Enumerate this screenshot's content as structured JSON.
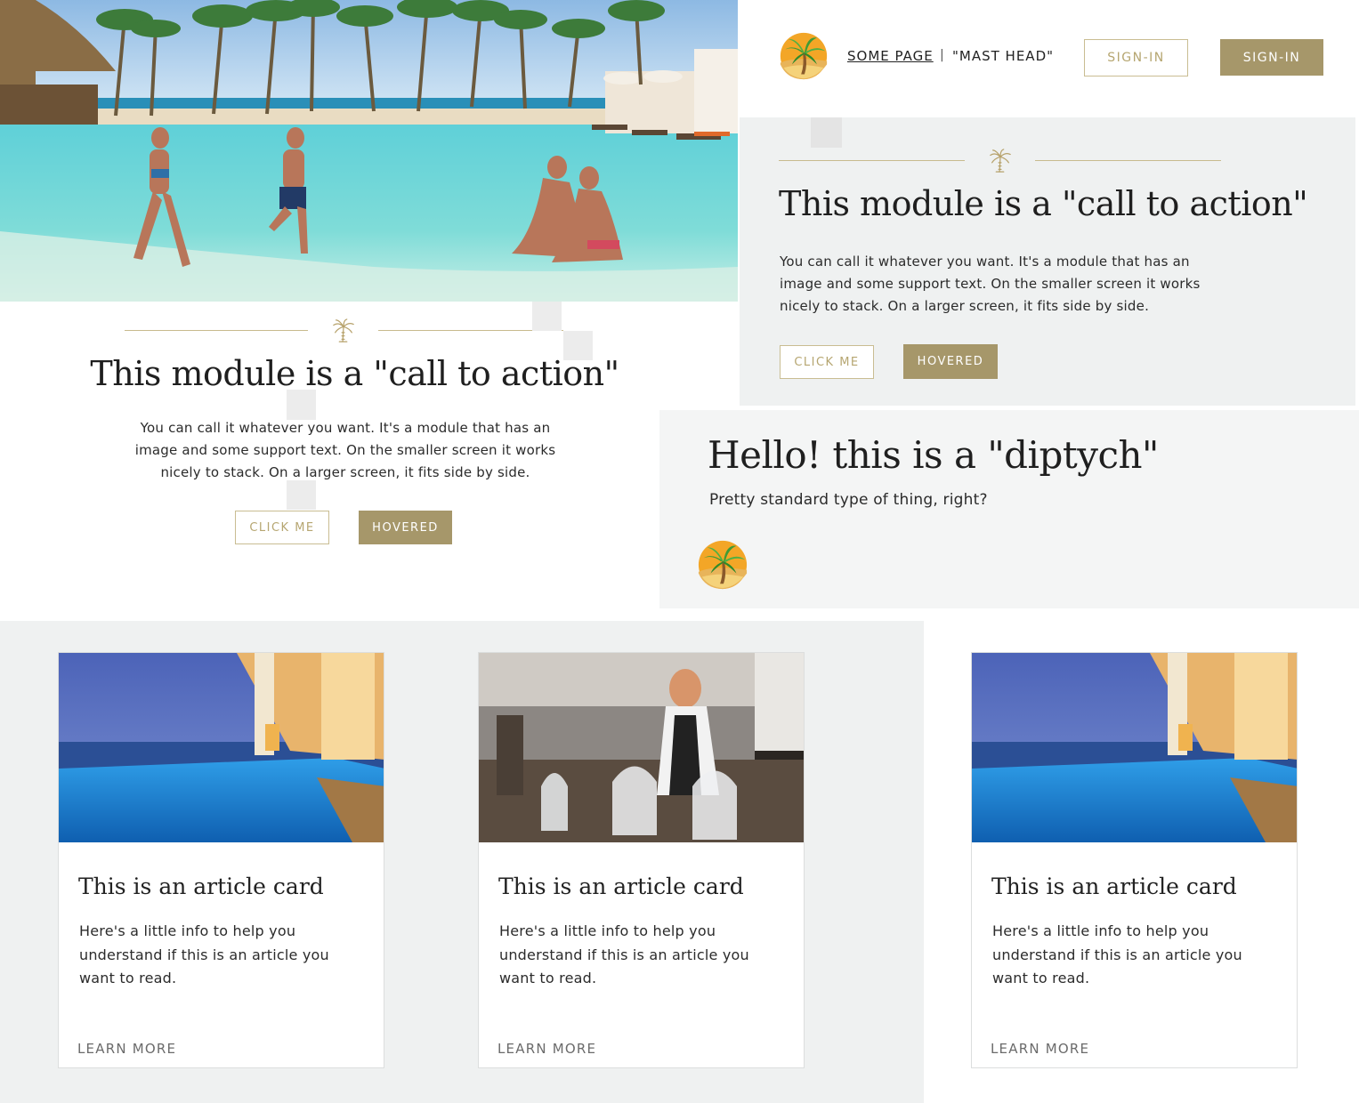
{
  "masthead": {
    "nav_link": "SOME PAGE",
    "separator": "|",
    "title": "\"MAST HEAD\"",
    "signin_outline": "SIGN-IN",
    "signin_solid": "SIGN-IN",
    "logo_icon": "palm-tree-logo"
  },
  "cta_left": {
    "heading": "This module is a \"call to action\"",
    "body": "You can call it whatever you want. It's a module that has an image and some support text. On the smaller screen it works nicely to stack. On a larger screen, it fits side by side.",
    "button_primary": "CLICK ME",
    "button_hovered": "HOVERED",
    "divider_icon": "palm-tree-icon"
  },
  "cta_right": {
    "heading": "This module is a \"call to action\"",
    "body": "You can call it whatever you want. It's a module that has an image and some support text. On the smaller screen it works nicely to stack. On a larger screen, it fits side by side.",
    "button_primary": "CLICK ME",
    "button_hovered": "HOVERED",
    "divider_icon": "palm-tree-icon"
  },
  "diptych": {
    "heading": "Hello! this is a \"diptych\"",
    "subtext": "Pretty standard type of thing, right?",
    "logo_icon": "palm-tree-logo"
  },
  "cards": [
    {
      "image": "infinity-pool-ocean-sunset",
      "title": "This is an article card",
      "body": "Here's a little info to help you understand if this is an article you want to read.",
      "link": "LEARN MORE"
    },
    {
      "image": "bartender-glass-domes",
      "title": "This is an article card",
      "body": "Here's a little info to help you understand if this is an article you want to read.",
      "link": "LEARN MORE"
    },
    {
      "image": "infinity-pool-ocean-sunset",
      "title": "This is an article card",
      "body": "Here's a little info to help you understand if this is an article you want to read.",
      "link": "LEARN MORE"
    }
  ],
  "colors": {
    "accent_gold": "#a6976a",
    "outline_gold": "#c9bd92",
    "panel_gray": "#eff1f1",
    "panel_gray_light": "#f4f5f5"
  },
  "hero_image": "resort-pool-family-palm-trees"
}
